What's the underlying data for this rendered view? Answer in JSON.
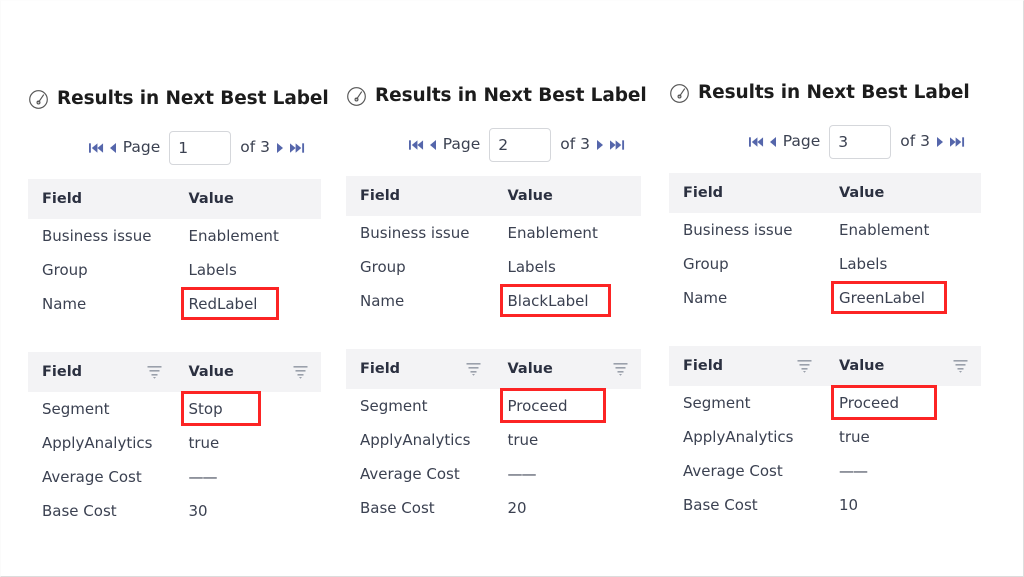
{
  "colors": {
    "accent_arrow": "#5566ab",
    "highlight_box": "#fc2424",
    "table_header_bg": "#f3f3f5",
    "text": "#3b4151",
    "heading": "#1c1c1c"
  },
  "panels": [
    {
      "title": "Results in Next Best Label",
      "icon": "gauge-icon",
      "pager": {
        "first_icon": "first-page-icon",
        "prev_icon": "previous-page-icon",
        "label": "Page",
        "value": "1",
        "of_label": "of 3",
        "next_icon": "next-page-icon",
        "last_icon": "last-page-icon"
      },
      "table_top": {
        "columns": [
          "Field",
          "Value"
        ],
        "rows": [
          {
            "field": "Business issue",
            "value": "Enablement",
            "highlight": false
          },
          {
            "field": "Group",
            "value": "Labels",
            "highlight": false
          },
          {
            "field": "Name",
            "value": "RedLabel",
            "highlight": true
          }
        ]
      },
      "table_bottom": {
        "columns": [
          "Field",
          "Value"
        ],
        "filter_icon": "filter-icon",
        "rows": [
          {
            "field": "Segment",
            "value": "Stop",
            "highlight": true
          },
          {
            "field": "ApplyAnalytics",
            "value": "true",
            "highlight": false
          },
          {
            "field": "Average Cost",
            "value": "——",
            "highlight": false
          },
          {
            "field": "Base Cost",
            "value": "30",
            "highlight": false
          }
        ]
      }
    },
    {
      "title": "Results in Next Best Label",
      "icon": "gauge-icon",
      "pager": {
        "first_icon": "first-page-icon",
        "prev_icon": "previous-page-icon",
        "label": "Page",
        "value": "2",
        "of_label": "of 3",
        "next_icon": "next-page-icon",
        "last_icon": "last-page-icon"
      },
      "table_top": {
        "columns": [
          "Field",
          "Value"
        ],
        "rows": [
          {
            "field": "Business issue",
            "value": "Enablement",
            "highlight": false
          },
          {
            "field": "Group",
            "value": "Labels",
            "highlight": false
          },
          {
            "field": "Name",
            "value": "BlackLabel",
            "highlight": true
          }
        ]
      },
      "table_bottom": {
        "columns": [
          "Field",
          "Value"
        ],
        "filter_icon": "filter-icon",
        "rows": [
          {
            "field": "Segment",
            "value": "Proceed",
            "highlight": true
          },
          {
            "field": "ApplyAnalytics",
            "value": "true",
            "highlight": false
          },
          {
            "field": "Average Cost",
            "value": "——",
            "highlight": false
          },
          {
            "field": "Base Cost",
            "value": "20",
            "highlight": false
          }
        ]
      }
    },
    {
      "title": "Results in Next Best Label",
      "icon": "gauge-icon",
      "pager": {
        "first_icon": "first-page-icon",
        "prev_icon": "previous-page-icon",
        "label": "Page",
        "value": "3",
        "of_label": "of 3",
        "next_icon": "next-page-icon",
        "last_icon": "last-page-icon"
      },
      "table_top": {
        "columns": [
          "Field",
          "Value"
        ],
        "rows": [
          {
            "field": "Business issue",
            "value": "Enablement",
            "highlight": false
          },
          {
            "field": "Group",
            "value": "Labels",
            "highlight": false
          },
          {
            "field": "Name",
            "value": "GreenLabel",
            "highlight": true
          }
        ]
      },
      "table_bottom": {
        "columns": [
          "Field",
          "Value"
        ],
        "filter_icon": "filter-icon",
        "rows": [
          {
            "field": "Segment",
            "value": "Proceed",
            "highlight": true
          },
          {
            "field": "ApplyAnalytics",
            "value": "true",
            "highlight": false
          },
          {
            "field": "Average Cost",
            "value": "——",
            "highlight": false
          },
          {
            "field": "Base Cost",
            "value": "10",
            "highlight": false
          }
        ]
      }
    }
  ]
}
